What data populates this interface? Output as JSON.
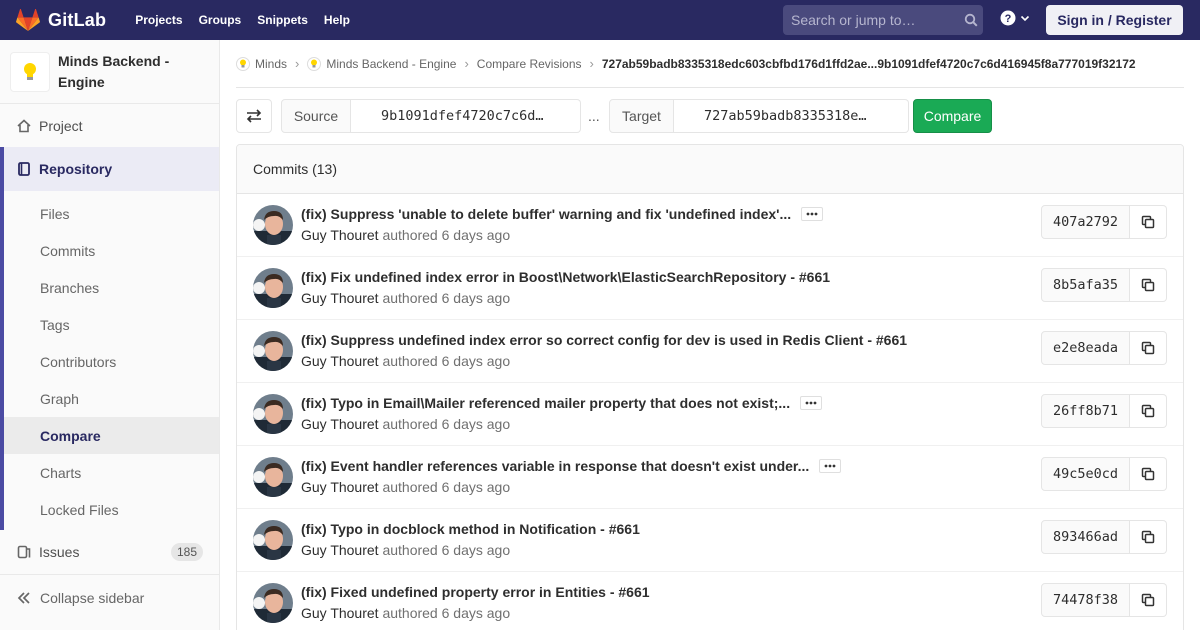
{
  "navbar": {
    "app_name": "GitLab",
    "links": [
      "Projects",
      "Groups",
      "Snippets",
      "Help"
    ],
    "search_placeholder": "Search or jump to…",
    "signin_label": "Sign in / Register",
    "colors": {
      "bg": "#292961",
      "search_bg": "#4a4a7d"
    }
  },
  "sidebar": {
    "project_name": "Minds Backend - Engine",
    "project_item": "Project",
    "repository_label": "Repository",
    "repository_items": [
      {
        "label": "Files"
      },
      {
        "label": "Commits"
      },
      {
        "label": "Branches"
      },
      {
        "label": "Tags"
      },
      {
        "label": "Contributors"
      },
      {
        "label": "Graph"
      },
      {
        "label": "Compare",
        "active": true
      },
      {
        "label": "Charts"
      },
      {
        "label": "Locked Files"
      }
    ],
    "issues_label": "Issues",
    "issues_count": "185",
    "collapse_label": "Collapse sidebar"
  },
  "breadcrumb": {
    "items": [
      "Minds",
      "Minds Backend - Engine",
      "Compare Revisions"
    ],
    "current": "727ab59badb8335318edc603cbfbd176d1ffd2ae...9b1091dfef4720c7c6d416945f8a777019f32172"
  },
  "compare": {
    "source_label": "Source",
    "source_value": "9b1091dfef4720c7c6d…",
    "separator": "...",
    "target_label": "Target",
    "target_value": "727ab59badb8335318e…",
    "compare_label": "Compare",
    "button_color": "#1aaa55"
  },
  "commits": {
    "header": "Commits (13)",
    "items": [
      {
        "title": "(fix) Suppress 'unable to delete buffer' warning and fix 'undefined index'...",
        "has_more": true,
        "author": "Guy Thouret",
        "action": "authored",
        "time": "6 days ago",
        "sha": "407a2792"
      },
      {
        "title": "(fix) Fix undefined index error in Boost\\Network\\ElasticSearchRepository - #661",
        "has_more": false,
        "author": "Guy Thouret",
        "action": "authored",
        "time": "6 days ago",
        "sha": "8b5afa35"
      },
      {
        "title": "(fix) Suppress undefined index error so correct config for dev is used in Redis Client - #661",
        "has_more": false,
        "author": "Guy Thouret",
        "action": "authored",
        "time": "6 days ago",
        "sha": "e2e8eada"
      },
      {
        "title": "(fix) Typo in Email\\Mailer referenced mailer property that does not exist;...",
        "has_more": true,
        "author": "Guy Thouret",
        "action": "authored",
        "time": "6 days ago",
        "sha": "26ff8b71"
      },
      {
        "title": "(fix) Event handler references variable in response that doesn't exist under...",
        "has_more": true,
        "author": "Guy Thouret",
        "action": "authored",
        "time": "6 days ago",
        "sha": "49c5e0cd"
      },
      {
        "title": "(fix) Typo in docblock method in Notification - #661",
        "has_more": false,
        "author": "Guy Thouret",
        "action": "authored",
        "time": "6 days ago",
        "sha": "893466ad"
      },
      {
        "title": "(fix) Fixed undefined property error in Entities - #661",
        "has_more": false,
        "author": "Guy Thouret",
        "action": "authored",
        "time": "6 days ago",
        "sha": "74478f38"
      }
    ]
  }
}
